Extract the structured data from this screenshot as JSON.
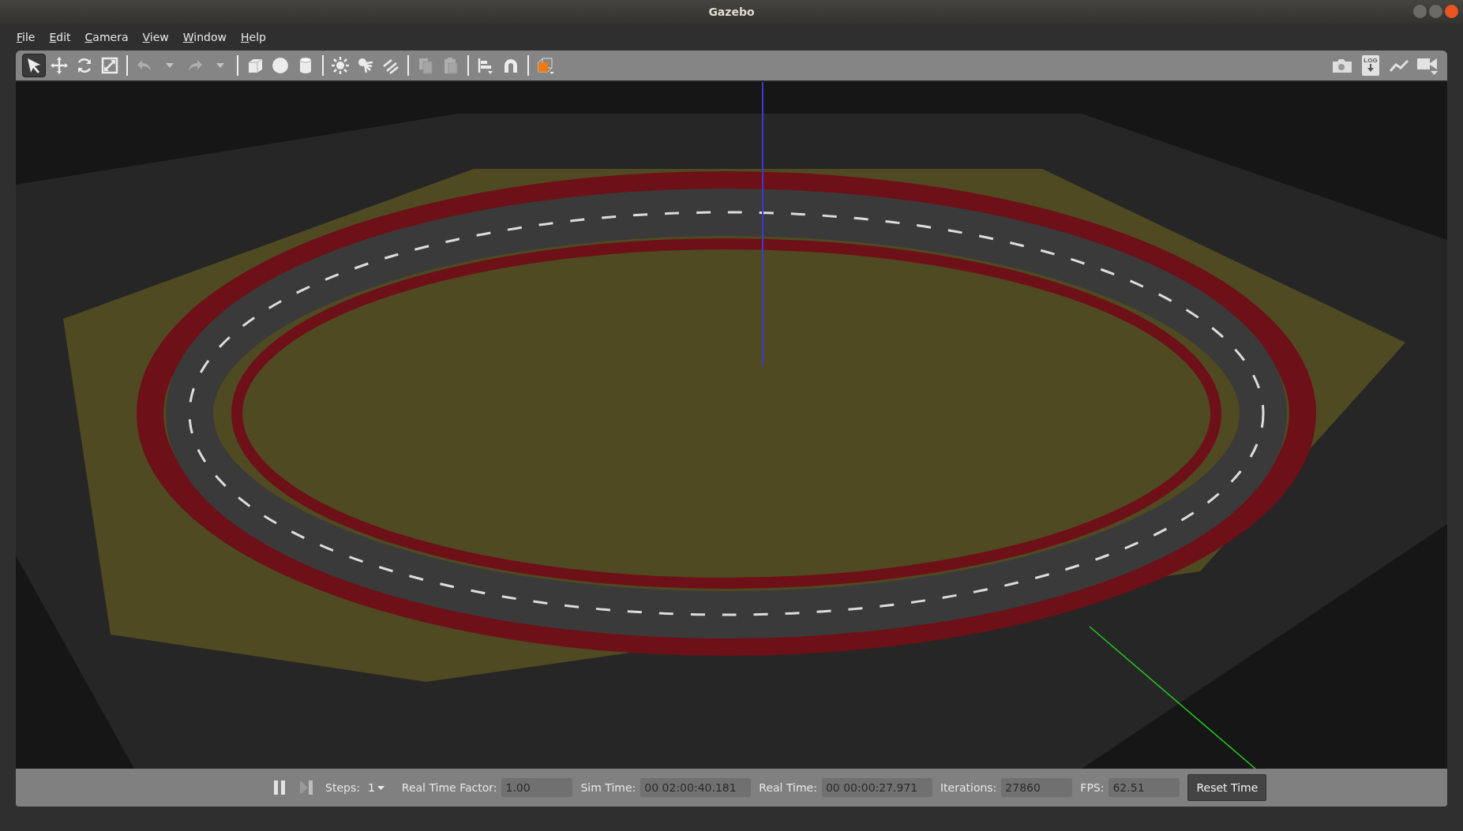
{
  "window": {
    "title": "Gazebo"
  },
  "menu": [
    "File",
    "Edit",
    "Camera",
    "View",
    "Window",
    "Help"
  ],
  "toolbar": {
    "tools": [
      {
        "selected": true,
        "disabled": false
      },
      {
        "selected": false,
        "disabled": false
      },
      {
        "selected": false,
        "disabled": false
      },
      {
        "selected": false,
        "disabled": false
      },
      {
        "selected": false,
        "disabled": true
      },
      {
        "selected": false,
        "disabled": true
      },
      {
        "selected": false,
        "disabled": false
      },
      {
        "selected": false,
        "disabled": false
      },
      {
        "selected": false,
        "disabled": false
      },
      {
        "selected": false,
        "disabled": false
      },
      {
        "selected": false,
        "disabled": false
      },
      {
        "selected": false,
        "disabled": false
      },
      {
        "selected": false,
        "disabled": true
      },
      {
        "selected": false,
        "disabled": true
      },
      {
        "selected": false,
        "disabled": false
      },
      {
        "selected": false,
        "disabled": false
      },
      {
        "selected": false,
        "disabled": false
      }
    ],
    "log_label": "LOG"
  },
  "bottom_bar": {
    "steps_label": "Steps:",
    "steps_value": "1",
    "fields": [
      {
        "label": "Real Time Factor:",
        "value": "1.00"
      },
      {
        "label": "Sim Time:",
        "value": "00 02:00:40.181"
      },
      {
        "label": "Real Time:",
        "value": "00 00:00:27.971"
      },
      {
        "label": "Iterations:",
        "value": "27860"
      },
      {
        "label": "FPS:",
        "value": "62.51"
      }
    ],
    "reset_button": "Reset Time"
  }
}
